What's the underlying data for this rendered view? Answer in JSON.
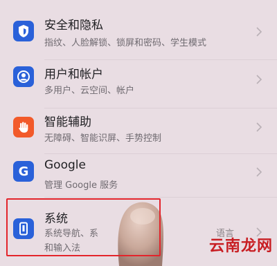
{
  "settings": {
    "items": [
      {
        "title": "安全和隐私",
        "subtitle": "指纹、人脸解锁、锁屏和密码、学生模式",
        "icon": "shield-icon",
        "icon_color": "#2a61d9"
      },
      {
        "title": "用户和帐户",
        "subtitle": "多用户、云空间、帐户",
        "icon": "user-icon",
        "icon_color": "#2a61d9"
      },
      {
        "title": "智能辅助",
        "subtitle": "无障碍、智能识屏、手势控制",
        "icon": "hand-icon",
        "icon_color": "#f25a2a"
      },
      {
        "title": "Google",
        "subtitle": "管理 Google 服务",
        "icon": "google-icon",
        "icon_color": "#2a61d9"
      },
      {
        "title": "系统",
        "subtitle": "系统导航、系",
        "subtitle_right": "语言",
        "subtitle2": "和输入法",
        "icon": "phone-icon",
        "icon_color": "#2a61d9"
      }
    ]
  },
  "highlight_color": "#e3242b",
  "watermark": "云南龙网"
}
